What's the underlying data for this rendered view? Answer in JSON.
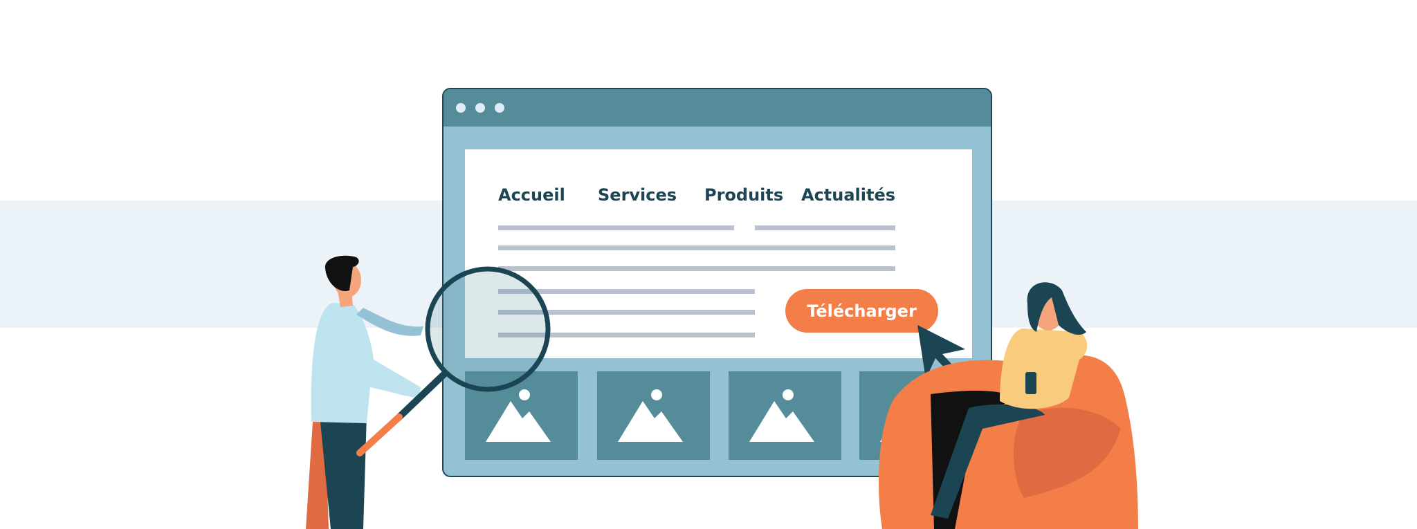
{
  "browser": {
    "nav": [
      "Accueil",
      "Services",
      "Produits",
      "Actualités"
    ],
    "download_button": "Télécharger",
    "thumbnails": [
      "image-icon",
      "image-icon",
      "image-icon",
      "image-icon"
    ]
  },
  "colors": {
    "accent": "#f47e48",
    "dark": "#1b4553",
    "window_frame": "#548c9a",
    "window_body": "#94c1d3",
    "band": "#ecf3f8"
  }
}
